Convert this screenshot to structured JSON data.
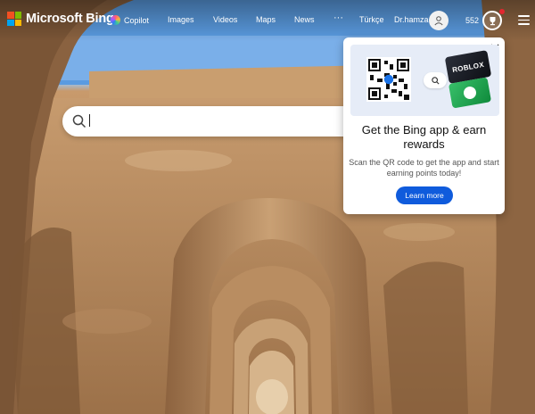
{
  "header": {
    "logo_text": "Microsoft Bing",
    "nav": [
      "Copilot",
      "Images",
      "Videos",
      "Maps",
      "News"
    ],
    "more": "···",
    "language": "Türkçe",
    "user_name": "Dr.hamza",
    "points": "552"
  },
  "search": {
    "value": "",
    "placeholder": ""
  },
  "popup": {
    "roblox_label": "ROBLOX",
    "title": "Get the Bing app & earn rewards",
    "description": "Scan the QR code to get the app and start earning points today!",
    "button_label": "Learn more"
  },
  "colors": {
    "accent": "#0f5bdc",
    "ms_red": "#f25022",
    "ms_green": "#7fba00",
    "ms_blue": "#00a4ef",
    "ms_yellow": "#ffb900"
  },
  "icons": [
    "microsoft-logo-icon",
    "copilot-icon",
    "user-icon",
    "trophy-icon",
    "menu-icon",
    "search-icon",
    "close-icon",
    "qr-code-icon",
    "xbox-icon"
  ]
}
